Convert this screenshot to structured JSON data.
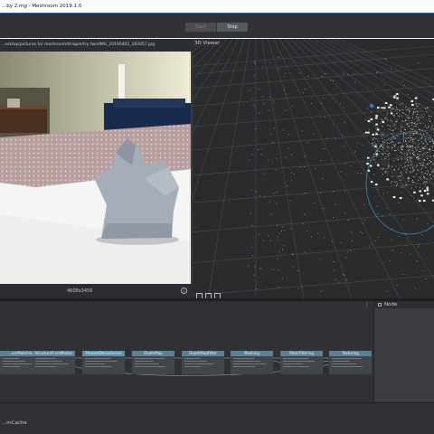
{
  "window": {
    "title": "...by 2.mg - Meshroom 2019.1.0"
  },
  "toolbar": {
    "start_label": "Start",
    "stop_label": "Stop",
    "progress_fraction": 1.0
  },
  "image_viewer": {
    "path": "...esktop/pictures for meshroom/dragon/try two/IMG_20190402_183057.jpg",
    "resolution": "4608x3456"
  },
  "viewer3d": {
    "title": "3D Viewer"
  },
  "graph_editor": {
    "menu_glyph": "⋮",
    "nodes": [
      {
        "name": "...ureMatching",
        "active": false
      },
      {
        "name": "StructureFromMotion",
        "active": false
      },
      {
        "name": "PrepareDenseScene",
        "active": true
      },
      {
        "name": "DepthMap",
        "active": false
      },
      {
        "name": "DepthMapFilter",
        "active": false
      },
      {
        "name": "Meshing",
        "active": false
      },
      {
        "name": "MeshFiltering",
        "active": false
      },
      {
        "name": "Texturing",
        "active": false
      }
    ]
  },
  "node_panel": {
    "title": "Node"
  },
  "status": {
    "cache_label": "...mCache"
  },
  "colors": {
    "accent": "#1f9a93",
    "node_header": "#5b7f95",
    "progress_start": "#e07b22"
  },
  "icons": [
    "info-icon",
    "square-icon",
    "grid-icon",
    "target-icon",
    "menu-dots-icon"
  ]
}
